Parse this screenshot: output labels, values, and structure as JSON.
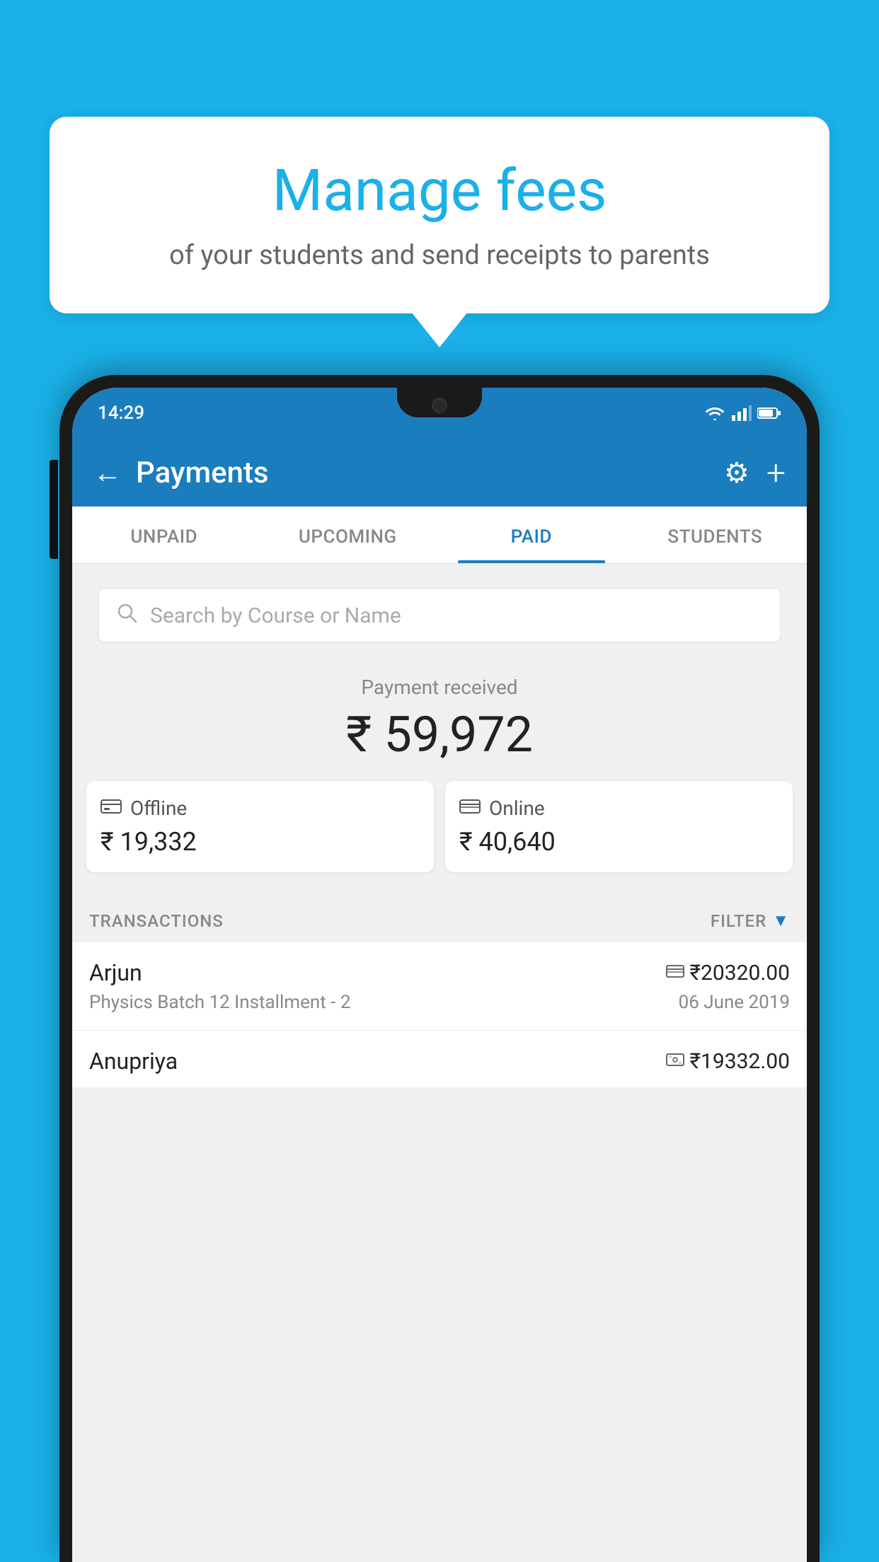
{
  "page": {
    "background_color": "#1ab0e8"
  },
  "speech_bubble": {
    "title": "Manage fees",
    "subtitle": "of your students and send receipts to parents"
  },
  "status_bar": {
    "time": "14:29"
  },
  "app_bar": {
    "title": "Payments",
    "back_label": "←",
    "gear_label": "⚙",
    "plus_label": "+"
  },
  "tabs": [
    {
      "id": "unpaid",
      "label": "UNPAID",
      "active": false
    },
    {
      "id": "upcoming",
      "label": "UPCOMING",
      "active": false
    },
    {
      "id": "paid",
      "label": "PAID",
      "active": true
    },
    {
      "id": "students",
      "label": "STUDENTS",
      "active": false
    }
  ],
  "search": {
    "placeholder": "Search by Course or Name"
  },
  "payment_summary": {
    "label": "Payment received",
    "total": "₹ 59,972",
    "offline": {
      "type": "Offline",
      "amount": "₹ 19,332"
    },
    "online": {
      "type": "Online",
      "amount": "₹ 40,640"
    }
  },
  "transactions": {
    "header_label": "TRANSACTIONS",
    "filter_label": "FILTER",
    "items": [
      {
        "name": "Arjun",
        "payment_mode": "card",
        "amount": "₹20320.00",
        "course": "Physics Batch 12 Installment - 2",
        "date": "06 June 2019"
      },
      {
        "name": "Anupriya",
        "payment_mode": "cash",
        "amount": "₹19332.00",
        "course": "",
        "date": ""
      }
    ]
  }
}
